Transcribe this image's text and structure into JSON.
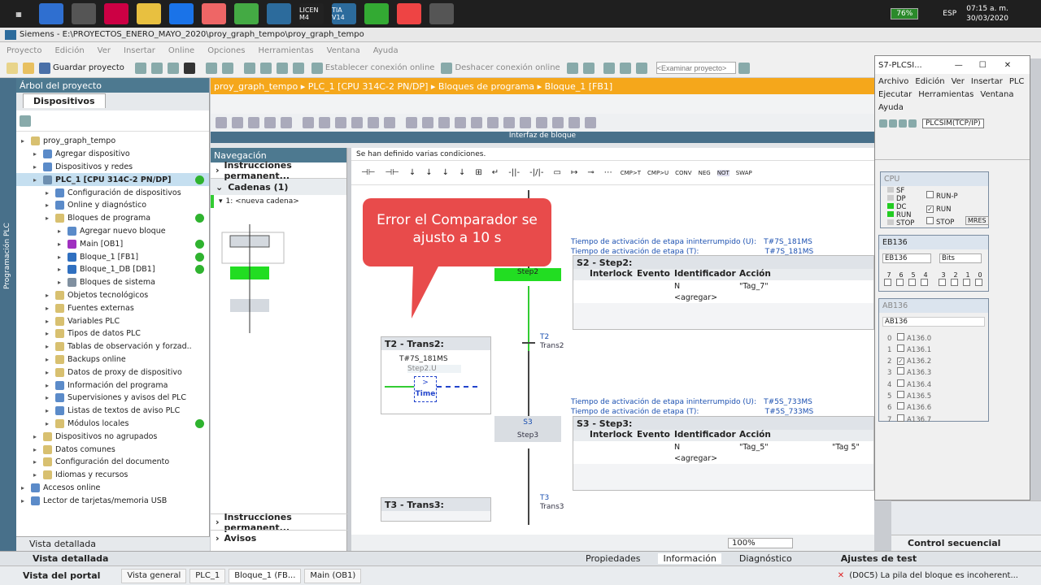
{
  "taskbar": {
    "apps": [
      "",
      "",
      "",
      "",
      "",
      "",
      "",
      "",
      "LICEN M4",
      "TIA V14",
      "",
      "",
      ""
    ],
    "battery": "76%",
    "lang": "ESP",
    "time": "07:15 a. m.",
    "date": "30/03/2020"
  },
  "window": {
    "title": "Siemens - E:\\PROYECTOS_ENERO_MAYO_2020\\proy_graph_tempo\\proy_graph_tempo"
  },
  "menu": [
    "Proyecto",
    "Edición",
    "Ver",
    "Insertar",
    "Online",
    "Opciones",
    "Herramientas",
    "Ventana",
    "Ayuda"
  ],
  "toolbar": {
    "save": "Guardar proyecto",
    "connect": "Establecer conexión online",
    "disconnect": "Deshacer conexión online",
    "search_placeholder": "<Examinar proyecto>"
  },
  "sidetab": "Programación PLC",
  "tree": {
    "header": "Árbol del proyecto",
    "tab": "Dispositivos",
    "items": [
      {
        "label": "proy_graph_tempo",
        "indent": 0,
        "color": "#d8c070",
        "ok": false
      },
      {
        "label": "Agregar dispositivo",
        "indent": 1,
        "color": "#5b8bc9",
        "ok": false
      },
      {
        "label": "Dispositivos y redes",
        "indent": 1,
        "color": "#5b8bc9",
        "ok": false
      },
      {
        "label": "PLC_1 [CPU 314C-2 PN/DP]",
        "indent": 1,
        "color": "#6d8fb0",
        "ok": true,
        "sel": true
      },
      {
        "label": "Configuración de dispositivos",
        "indent": 2,
        "color": "#5b8bc9",
        "ok": false
      },
      {
        "label": "Online y diagnóstico",
        "indent": 2,
        "color": "#5b8bc9",
        "ok": false
      },
      {
        "label": "Bloques de programa",
        "indent": 2,
        "color": "#d8c070",
        "ok": true
      },
      {
        "label": "Agregar nuevo bloque",
        "indent": 3,
        "color": "#5b8bc9",
        "ok": false
      },
      {
        "label": "Main [OB1]",
        "indent": 3,
        "color": "#a030c0",
        "ok": true
      },
      {
        "label": "Bloque_1 [FB1]",
        "indent": 3,
        "color": "#3070c0",
        "ok": true
      },
      {
        "label": "Bloque_1_DB [DB1]",
        "indent": 3,
        "color": "#3070c0",
        "ok": true
      },
      {
        "label": "Bloques de sistema",
        "indent": 3,
        "color": "#8090a0",
        "ok": false
      },
      {
        "label": "Objetos tecnológicos",
        "indent": 2,
        "color": "#d8c070",
        "ok": false
      },
      {
        "label": "Fuentes externas",
        "indent": 2,
        "color": "#d8c070",
        "ok": false
      },
      {
        "label": "Variables PLC",
        "indent": 2,
        "color": "#d8c070",
        "ok": false
      },
      {
        "label": "Tipos de datos PLC",
        "indent": 2,
        "color": "#d8c070",
        "ok": false
      },
      {
        "label": "Tablas de observación y forzad..",
        "indent": 2,
        "color": "#d8c070",
        "ok": false
      },
      {
        "label": "Backups online",
        "indent": 2,
        "color": "#d8c070",
        "ok": false
      },
      {
        "label": "Datos de proxy de dispositivo",
        "indent": 2,
        "color": "#d8c070",
        "ok": false
      },
      {
        "label": "Información del programa",
        "indent": 2,
        "color": "#5b8bc9",
        "ok": false
      },
      {
        "label": "Supervisiones y avisos del PLC",
        "indent": 2,
        "color": "#5b8bc9",
        "ok": false
      },
      {
        "label": "Listas de textos de aviso PLC",
        "indent": 2,
        "color": "#5b8bc9",
        "ok": false
      },
      {
        "label": "Módulos locales",
        "indent": 2,
        "color": "#d8c070",
        "ok": true
      },
      {
        "label": "Dispositivos no agrupados",
        "indent": 1,
        "color": "#d8c070",
        "ok": false
      },
      {
        "label": "Datos comunes",
        "indent": 1,
        "color": "#d8c070",
        "ok": false
      },
      {
        "label": "Configuración del documento",
        "indent": 1,
        "color": "#d8c070",
        "ok": false
      },
      {
        "label": "Idiomas y recursos",
        "indent": 1,
        "color": "#d8c070",
        "ok": false
      },
      {
        "label": "Accesos online",
        "indent": 0,
        "color": "#5b8bc9",
        "ok": false
      },
      {
        "label": "Lector de tarjetas/memoria USB",
        "indent": 0,
        "color": "#5b8bc9",
        "ok": false
      }
    ],
    "detail": "Vista detallada"
  },
  "breadcrumb": "proy_graph_tempo  ▸  PLC_1 [CPU 314C-2 PN/DP]  ▸  Bloques de programa  ▸  Bloque_1 [FB1]",
  "iface": "Interfaz de bloque",
  "nav": {
    "header": "Navegación",
    "perm": "Instrucciones permanent...",
    "cadenas": "Cadenas (1)",
    "chain": "1: <nueva cadena>",
    "perm2": "Instrucciones permanent...",
    "avisos": "Avisos"
  },
  "editor": {
    "info": "Se han definido varias condiciones.",
    "step2": {
      "num": "S2",
      "name": "Step2",
      "hdr": "S2 - Step2:",
      "t1": "Tiempo de activación de etapa ininterrumpido (U):",
      "v1": "T#7S_181MS",
      "t2": "Tiempo de activación de etapa (T):",
      "v2": "T#7S_181MS",
      "ident": "N",
      "action": "\"Tag_7\"",
      "add": "<agregar>"
    },
    "trans2": {
      "hdr": "T2 - Trans2:",
      "label": "T2",
      "name": "Trans2",
      "val": "T#7S_181MS",
      "op": "Step2.U",
      "cmp": ">",
      "time": "Time"
    },
    "step3": {
      "num": "S3",
      "name": "Step3",
      "hdr": "S3 - Step3:",
      "t1": "Tiempo de activación de etapa ininterrumpido (U):",
      "v1": "T#5S_733MS",
      "t2": "Tiempo de activación de etapa (T):",
      "v2": "T#5S_733MS",
      "ident": "N",
      "action": "\"Tag_5\"",
      "action2": "\"Tag 5\"",
      "add": "<agregar>"
    },
    "trans3": {
      "hdr": "T3 - Trans3:",
      "label": "T3",
      "name": "Trans3"
    },
    "cols": [
      "Interlock",
      "Evento",
      "Identificador",
      "Acción"
    ],
    "zoom": "100%"
  },
  "callout": "Error el Comparador se ajusto a 10 s",
  "plcsim": {
    "title": "S7-PLCSI...",
    "menu": [
      "Archivo",
      "Edición",
      "Ver",
      "Insertar",
      "PLC",
      "Ejecutar",
      "Herramientas",
      "Ventana",
      "Ayuda"
    ],
    "conn": "PLCSIM(TCP/IP)",
    "cpu": {
      "title": "CPU",
      "leds": [
        "SF",
        "DP",
        "DC",
        "RUN",
        "STOP"
      ],
      "modes": [
        "RUN-P",
        "RUN",
        "STOP"
      ],
      "mres": "MRES"
    },
    "eb": {
      "title": "EB136",
      "addr": "EB136",
      "fmt": "Bits",
      "bits": [
        "7",
        "6",
        "5",
        "4",
        "3",
        "2",
        "1",
        "0"
      ]
    },
    "ab": {
      "title": "AB136",
      "addr": "AB136",
      "rows": [
        "A136.0",
        "A136.1",
        "A136.2",
        "A136.3",
        "A136.4",
        "A136.5",
        "A136.6",
        "A136.7"
      ]
    }
  },
  "right": {
    "seq": "Control secuencial",
    "tests": "Ajustes de test"
  },
  "bottom": {
    "props": "Propiedades",
    "info": "Información",
    "diag": "Diagnóstico"
  },
  "portal": {
    "view": "Vista del portal",
    "tabs": [
      "Vista general",
      "PLC_1",
      "Bloque_1 (FB...",
      "Main (OB1)"
    ],
    "status": "(D0C5) La pila del bloque es incoherent..."
  }
}
